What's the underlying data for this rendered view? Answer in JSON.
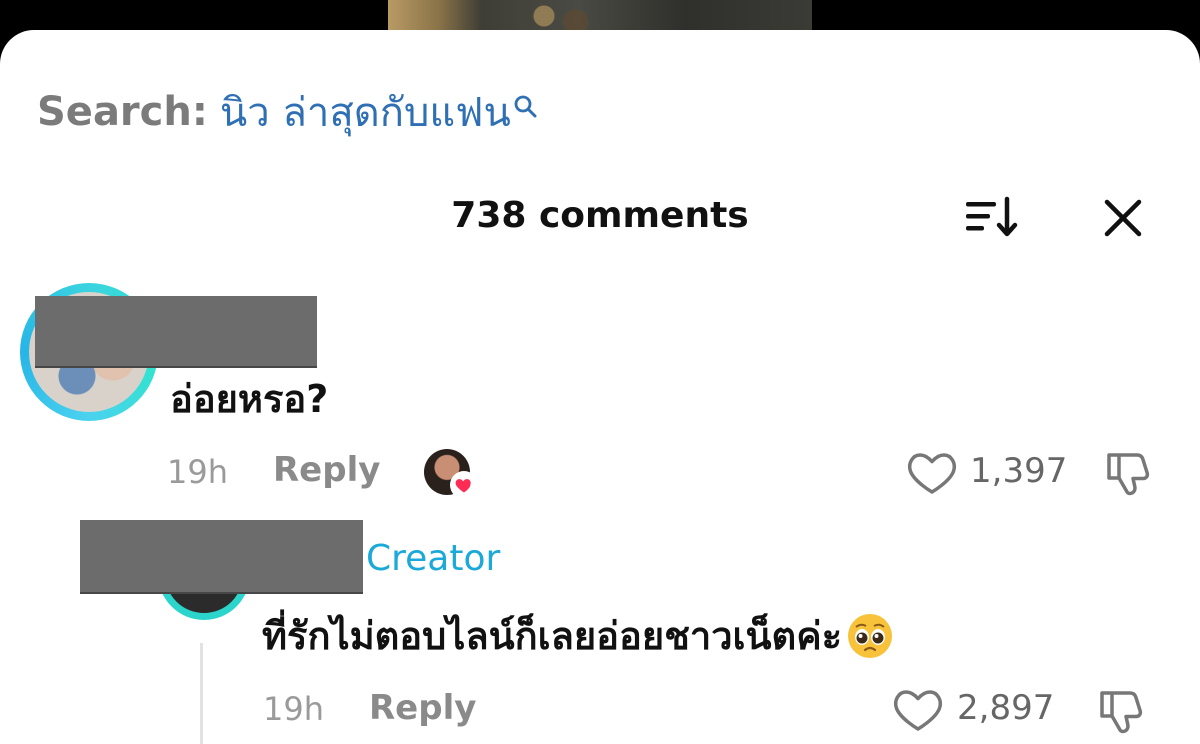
{
  "search": {
    "label": "Search:",
    "query": "นิว ล่าสุดกับแฟน"
  },
  "header": {
    "title": "738 comments"
  },
  "comments": [
    {
      "text": "อ่อยหรอ?",
      "time": "19h",
      "reply_label": "Reply",
      "likes": "1,397",
      "liked_by_creator": true
    },
    {
      "creator_tag": "Creator",
      "text": "ที่รักไม่ตอบไลน์ก็เลยอ่อยชาวเน็ตค่ะ",
      "emoji": "pleading-face",
      "time": "19h",
      "reply_label": "Reply",
      "likes": "2,897"
    }
  ],
  "colors": {
    "query": "#2f6fb3",
    "creator": "#1aa9d8",
    "heart": "#fe2c55",
    "ring": "#2cd5cc"
  },
  "icons": [
    "search-icon",
    "sort-icon",
    "close-icon",
    "heart-icon",
    "dislike-icon"
  ]
}
